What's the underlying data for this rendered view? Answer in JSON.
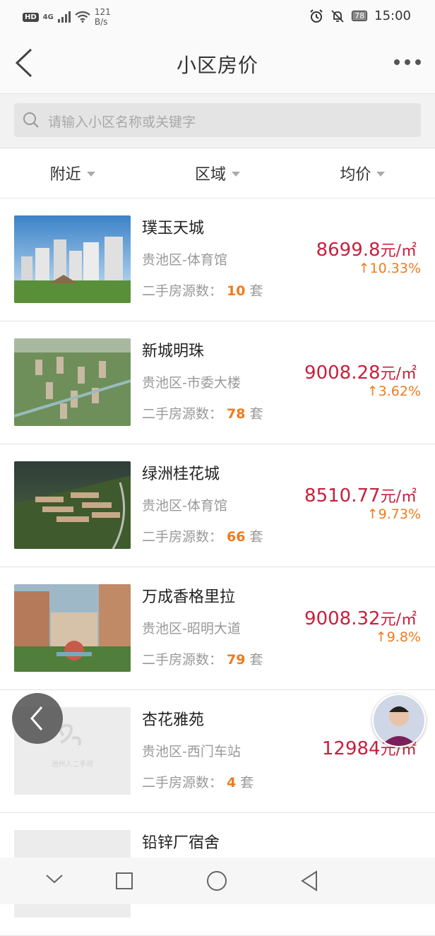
{
  "status_bar": {
    "hd": "HD",
    "network": "4G",
    "speed_value": "121",
    "speed_unit": "B/s",
    "battery": "78",
    "time": "15:00"
  },
  "header": {
    "title": "小区房价",
    "back_icon": "chevron-left-icon",
    "more_icon": "more-dots-icon"
  },
  "search": {
    "placeholder": "请输入小区名称或关键字"
  },
  "filters": [
    {
      "label": "附近"
    },
    {
      "label": "区域"
    },
    {
      "label": "均价"
    }
  ],
  "count_prefix": "二手房源数：",
  "count_suffix": "套",
  "listings": [
    {
      "name": "璞玉天城",
      "location": "贵池区-体育馆",
      "count": "10",
      "price": "8699.8",
      "unit": "元/㎡",
      "change": "10.33%",
      "thumb": "towers"
    },
    {
      "name": "新城明珠",
      "location": "贵池区-市委大楼",
      "count": "78",
      "price": "9008.28",
      "unit": "元/㎡",
      "change": "3.62%",
      "thumb": "aerial-green"
    },
    {
      "name": "绿洲桂花城",
      "location": "贵池区-体育馆",
      "count": "66",
      "price": "8510.77",
      "unit": "元/㎡",
      "change": "9.73%",
      "thumb": "aerial-dusk"
    },
    {
      "name": "万成香格里拉",
      "location": "贵池区-昭明大道",
      "count": "79",
      "price": "9008.32",
      "unit": "元/㎡",
      "change": "9.8%",
      "thumb": "garden"
    },
    {
      "name": "杏花雅苑",
      "location": "贵池区-西门车站",
      "count": "4",
      "price": "12984",
      "unit": "元/㎡",
      "change": "",
      "thumb": "placeholder"
    },
    {
      "name": "铅锌厂宿舍",
      "location": "",
      "count": "",
      "price": "",
      "unit": "",
      "change": "",
      "thumb": "placeholder"
    }
  ],
  "placeholder_caption": "池州人二手房",
  "colors": {
    "price": "#c8203e",
    "accent": "#f07b1d",
    "muted": "#999999"
  }
}
